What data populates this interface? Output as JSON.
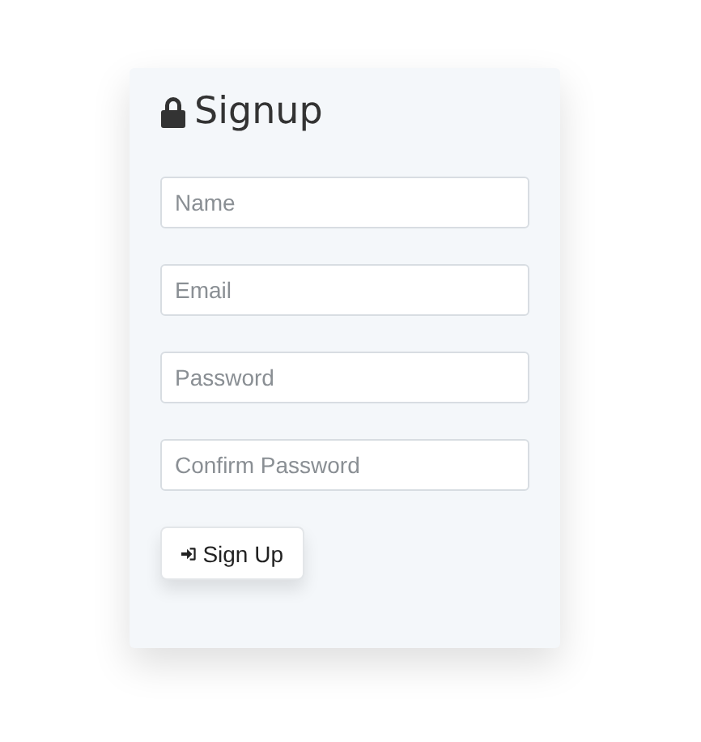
{
  "title": "Signup",
  "fields": [
    {
      "placeholder": "Name"
    },
    {
      "placeholder": "Email"
    },
    {
      "placeholder": "Password"
    },
    {
      "placeholder": "Confirm Password"
    }
  ],
  "button": {
    "label": "Sign Up"
  }
}
